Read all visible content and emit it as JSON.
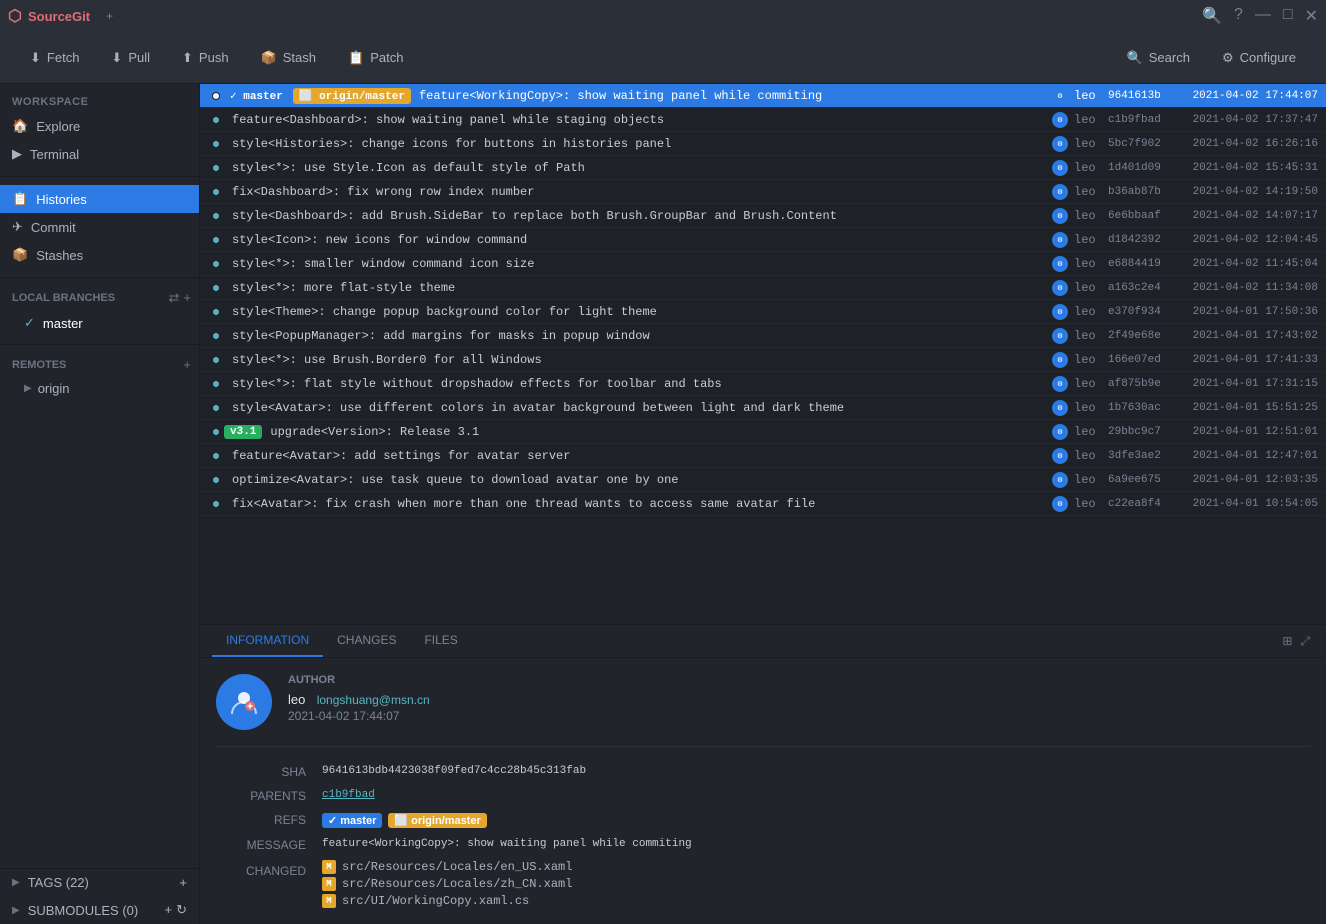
{
  "app": {
    "title": "SourceGit",
    "tab_close": "✕",
    "tab_add": "+"
  },
  "titlebar": {
    "brand": "SourceGit",
    "controls": [
      "⚙",
      "?",
      "—",
      "□",
      "✕"
    ]
  },
  "toolbar": {
    "fetch_label": "Fetch",
    "pull_label": "Pull",
    "push_label": "Push",
    "stash_label": "Stash",
    "patch_label": "Patch",
    "search_label": "Search",
    "configure_label": "Configure"
  },
  "sidebar": {
    "workspace_label": "WORKSPACE",
    "explore_label": "Explore",
    "terminal_label": "Terminal",
    "histories_label": "Histories",
    "commit_label": "Commit",
    "stashes_label": "Stashes",
    "local_branches_label": "LOCAL BRANCHES",
    "master_branch": "master",
    "remotes_label": "REMOTES",
    "origin_remote": "origin",
    "tags_label": "TAGS (22)",
    "submodules_label": "SUBMODULES (0)"
  },
  "commits": [
    {
      "refs": [
        {
          "label": "master",
          "type": "master"
        },
        {
          "label": "origin/master",
          "type": "origin"
        }
      ],
      "message": "feature<WorkingCopy>: show waiting panel while commiting",
      "author": "leo",
      "hash": "9641613b",
      "date": "2021-04-02 17:44:07",
      "selected": true
    },
    {
      "refs": [],
      "message": "feature<Dashboard>: show waiting panel while staging objects",
      "author": "leo",
      "hash": "c1b9fbad",
      "date": "2021-04-02 17:37:47",
      "selected": false
    },
    {
      "refs": [],
      "message": "style<Histories>: change icons for buttons in histories panel",
      "author": "leo",
      "hash": "5bc7f902",
      "date": "2021-04-02 16:26:16",
      "selected": false
    },
    {
      "refs": [],
      "message": "style<*>: use Style.Icon as default style of Path",
      "author": "leo",
      "hash": "1d401d09",
      "date": "2021-04-02 15:45:31",
      "selected": false
    },
    {
      "refs": [],
      "message": "fix<Dashboard>: fix wrong row index number",
      "author": "leo",
      "hash": "b36ab87b",
      "date": "2021-04-02 14:19:50",
      "selected": false
    },
    {
      "refs": [],
      "message": "style<Dashboard>: add Brush.SideBar to replace both Brush.GroupBar and Brush.Content",
      "author": "leo",
      "hash": "6e6bbaaf",
      "date": "2021-04-02 14:07:17",
      "selected": false
    },
    {
      "refs": [],
      "message": "style<Icon>: new icons for window command",
      "author": "leo",
      "hash": "d1842392",
      "date": "2021-04-02 12:04:45",
      "selected": false
    },
    {
      "refs": [],
      "message": "style<*>: smaller window command icon size",
      "author": "leo",
      "hash": "e6884419",
      "date": "2021-04-02 11:45:04",
      "selected": false
    },
    {
      "refs": [],
      "message": "style<*>: more flat-style theme",
      "author": "leo",
      "hash": "a163c2e4",
      "date": "2021-04-02 11:34:08",
      "selected": false
    },
    {
      "refs": [],
      "message": "style<Theme>: change popup background color for light theme",
      "author": "leo",
      "hash": "e370f934",
      "date": "2021-04-01 17:50:36",
      "selected": false
    },
    {
      "refs": [],
      "message": "style<PopupManager>: add margins for masks in popup window",
      "author": "leo",
      "hash": "2f49e68e",
      "date": "2021-04-01 17:43:02",
      "selected": false
    },
    {
      "refs": [],
      "message": "style<*>: use Brush.Border0 for all Windows",
      "author": "leo",
      "hash": "166e07ed",
      "date": "2021-04-01 17:41:33",
      "selected": false
    },
    {
      "refs": [],
      "message": "style<*>: flat style without dropshadow effects for toolbar and tabs",
      "author": "leo",
      "hash": "af875b9e",
      "date": "2021-04-01 17:31:15",
      "selected": false
    },
    {
      "refs": [],
      "message": "style<Avatar>: use different colors in avatar background between light and dark theme",
      "author": "leo",
      "hash": "1b7630ac",
      "date": "2021-04-01 15:51:25",
      "selected": false
    },
    {
      "refs": [
        {
          "label": "v3.1",
          "type": "version"
        }
      ],
      "message": "upgrade<Version>: Release 3.1",
      "author": "leo",
      "hash": "29bbc9c7",
      "date": "2021-04-01 12:51:01",
      "selected": false
    },
    {
      "refs": [],
      "message": "feature<Avatar>: add settings for avatar server",
      "author": "leo",
      "hash": "3dfe3ae2",
      "date": "2021-04-01 12:47:01",
      "selected": false
    },
    {
      "refs": [],
      "message": "optimize<Avatar>: use task queue to download avatar one by one",
      "author": "leo",
      "hash": "6a9ee675",
      "date": "2021-04-01 12:03:35",
      "selected": false
    },
    {
      "refs": [],
      "message": "fix<Avatar>: fix crash when more than one thread wants to access same avatar file",
      "author": "leo",
      "hash": "c22ea8f4",
      "date": "2021-04-01 10:54:05",
      "selected": false
    }
  ],
  "detail": {
    "tabs": [
      "INFORMATION",
      "CHANGES",
      "FILES"
    ],
    "active_tab": "INFORMATION",
    "author_section_label": "AUTHOR",
    "author_name": "leo",
    "author_email": "longshuang@msn.cn",
    "author_date": "2021-04-02 17:44:07",
    "sha_label": "SHA",
    "sha_value": "9641613bdb4423038f09fed7c4cc28b45c313fab",
    "parents_label": "PARENTS",
    "parents_value": "c1b9fbad",
    "refs_label": "REFS",
    "refs_master": "master",
    "refs_origin": "origin/master",
    "message_label": "MESSAGE",
    "message_value": "feature<WorkingCopy>: show waiting panel while commiting",
    "changed_label": "CHANGED",
    "changed_files": [
      "src/Resources/Locales/en_US.xaml",
      "src/Resources/Locales/zh_CN.xaml",
      "src/UI/WorkingCopy.xaml.cs"
    ]
  }
}
